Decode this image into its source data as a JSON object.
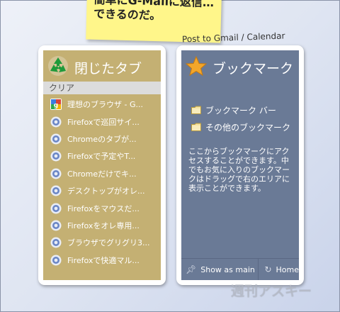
{
  "sticky_note": {
    "line1": "簡単にG-Mailに返信…",
    "line2": "できるのだ。"
  },
  "caption": "Post to Gmail / Calendar",
  "closed_tabs": {
    "title": "閉じたタブ",
    "icon": "recycle-icon",
    "clear_label": "クリア",
    "items": [
      {
        "label": "理想のブラウザ - G...",
        "icon": "google-favicon"
      },
      {
        "label": "Firefoxで巡回サイ...",
        "icon": "globe-favicon"
      },
      {
        "label": "Chromeのタブが...",
        "icon": "globe-favicon"
      },
      {
        "label": "Firefoxで予定やT...",
        "icon": "globe-favicon"
      },
      {
        "label": "Chromeだけでキ...",
        "icon": "globe-favicon"
      },
      {
        "label": "デスクトップがオレ...",
        "icon": "globe-favicon"
      },
      {
        "label": "Firefoxをマウスだ...",
        "icon": "globe-favicon"
      },
      {
        "label": "Firefoxをオレ専用...",
        "icon": "globe-favicon"
      },
      {
        "label": "ブラウザでグリグリ3...",
        "icon": "globe-favicon"
      },
      {
        "label": "Firefoxで快適マル...",
        "icon": "globe-favicon"
      }
    ]
  },
  "bookmarks": {
    "title": "ブックマーク",
    "icon": "star-icon",
    "items": [
      {
        "label": "ブックマーク バー",
        "icon": "folder-icon"
      },
      {
        "label": "その他のブックマーク",
        "icon": "folder-icon"
      }
    ],
    "info": "ここからブックマークにアクセスすることができます。中でもお気に入りのブックマークはドラッグで右のエリアに表示ことができます。",
    "show_as_main": "Show as main",
    "home": "Home"
  },
  "watermark": "週刊アスキー",
  "colors": {
    "closed_tabs_bg": "#c4b073",
    "bookmarks_bg": "#6a7a96",
    "sticky": "#fff68a"
  }
}
